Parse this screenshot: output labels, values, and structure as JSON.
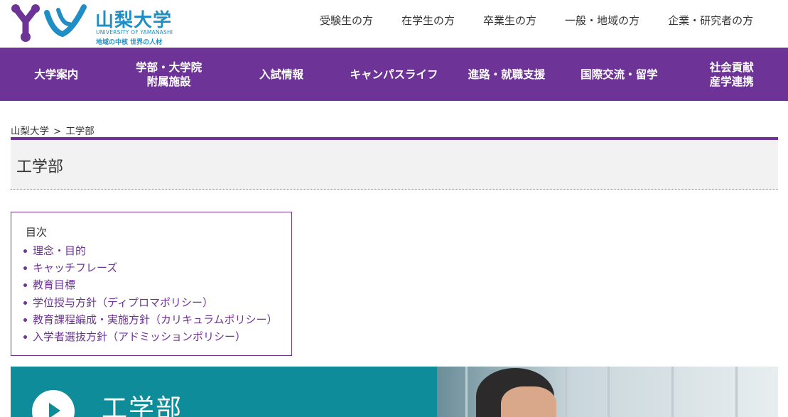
{
  "logo": {
    "name_jp": "山梨大学",
    "name_en": "UNIVERSITY OF YAMANASHI",
    "tagline": "地域の中核 世界の人材"
  },
  "util_nav": [
    "受験生の方",
    "在学生の方",
    "卒業生の方",
    "一般・地域の方",
    "企業・研究者の方"
  ],
  "global_nav": [
    "大学案内",
    "学部・大学院\n附属施設",
    "入試情報",
    "キャンパスライフ",
    "進路・就職支援",
    "国際交流・留学",
    "社会貢献\n産学連携"
  ],
  "breadcrumb": {
    "home": "山梨大学",
    "separator": ">",
    "current": "工学部"
  },
  "page_title": "工学部",
  "toc": {
    "title": "目次",
    "items": [
      "理念・目的",
      "キャッチフレーズ",
      "教育目標",
      "学位授与方針（ディプロマポリシー）",
      "教育課程編成・実施方針（カリキュラムポリシー）",
      "入学者選抜方針（アドミッションポリシー）"
    ]
  },
  "banner": {
    "title": "工学部"
  },
  "colors": {
    "purple": "#6d3396",
    "logo_blue": "#1e8ec4",
    "banner_teal": "#0f8c9a"
  }
}
